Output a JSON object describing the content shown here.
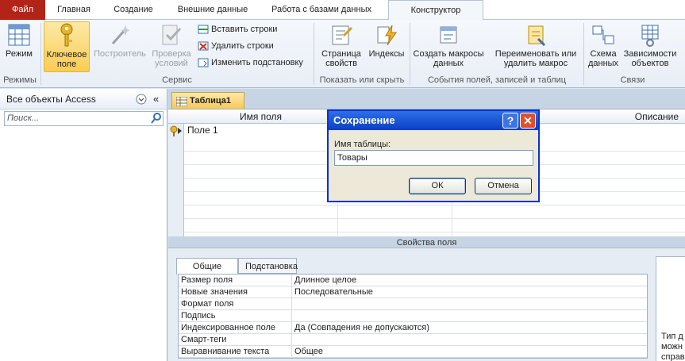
{
  "tabs": {
    "file": "Файл",
    "home": "Главная",
    "create": "Создание",
    "external": "Внешние данные",
    "database": "Работа с базами данных",
    "design": "Конструктор"
  },
  "ribbon": {
    "view": "Режим",
    "primary_key": "Ключевое поле",
    "builder": "Построитель",
    "test_rules": "Проверка условий",
    "insert_rows": "Вставить строки",
    "delete_rows": "Удалить строки",
    "modify_lookups": "Изменить подстановку",
    "property_sheet": "Страница свойств",
    "indexes": "Индексы",
    "create_macros": "Создать макросы данных",
    "rename_macro": "Переименовать или удалить макрос",
    "relationships": "Схема данных",
    "dependencies": "Зависимости объектов",
    "group_views": "Режимы",
    "group_tools": "Сервис",
    "group_show": "Показать или скрыть",
    "group_events": "События полей, записей и таблиц",
    "group_relationships": "Связи"
  },
  "nav": {
    "title": "Все объекты Access",
    "search_placeholder": "Поиск..."
  },
  "document": {
    "tab": "Таблица1",
    "col_field": "Имя поля",
    "col_desc": "Описание",
    "rows": [
      "Поле 1"
    ],
    "field_props_title": "Свойства поля"
  },
  "props": {
    "tab_general": "Общие",
    "tab_lookup": "Подстановка",
    "rows": [
      {
        "name": "Размер поля",
        "value": "Длинное целое"
      },
      {
        "name": "Новые значения",
        "value": "Последовательные"
      },
      {
        "name": "Формат поля",
        "value": ""
      },
      {
        "name": "Подпись",
        "value": ""
      },
      {
        "name": "Индексированное поле",
        "value": "Да (Совпадения не допускаются)"
      },
      {
        "name": "Смарт-теги",
        "value": ""
      },
      {
        "name": "Выравнивание текста",
        "value": "Общее"
      }
    ],
    "hint_lines": [
      "Тип д",
      "можн",
      "справ"
    ]
  },
  "dialog": {
    "title": "Сохранение",
    "help": "?",
    "close": "✕",
    "label": "Имя таблицы:",
    "value": "Товары",
    "ok": "ОК",
    "cancel": "Отмена"
  },
  "colors": {
    "file_tab": "#b32418",
    "accent": "#f9cc55",
    "dialog_title": "#0a3fc4"
  }
}
